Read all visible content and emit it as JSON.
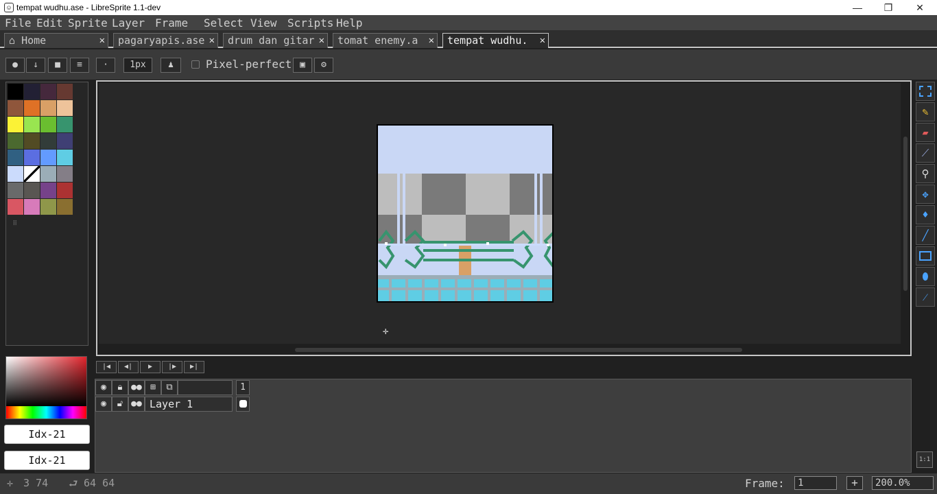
{
  "window": {
    "title": "tempat wudhu.ase - LibreSprite 1.1-dev",
    "minimize_glyph": "—",
    "maximize_glyph": "❐",
    "close_glyph": "✕"
  },
  "menu": [
    "File",
    "Edit",
    "Sprite",
    "Layer",
    "Frame",
    "Select",
    "View",
    "Scripts",
    "Help"
  ],
  "tabs": [
    {
      "label": "Home",
      "active": false
    },
    {
      "label": "pagaryapis.ase",
      "active": false
    },
    {
      "label": "drum dan gitar",
      "active": false
    },
    {
      "label": "tomat enemy.a",
      "active": false
    },
    {
      "label": "tempat wudhu.",
      "active": true
    }
  ],
  "tab_close": "✕",
  "context_bar": {
    "brush_size": "1px",
    "pixel_perfect_label": "Pixel-perfect",
    "pixel_perfect_checked": false
  },
  "palette": [
    "#000000",
    "#222034",
    "#45283c",
    "#663931",
    "#8f563b",
    "#df7126",
    "#d9a066",
    "#eec39a",
    "#fbf236",
    "#99e550",
    "#6abe30",
    "#37946e",
    "#4b692f",
    "#524b24",
    "#323c39",
    "#3f3f74",
    "#306082",
    "#5b6ee1",
    "#639bff",
    "#5fcde4",
    "#cbdbfc",
    "#ffffff",
    "#9badb7",
    "#847e87",
    "#696a6a",
    "#595652",
    "#76428a",
    "#ac3232",
    "#d95763",
    "#d77bba",
    "#8f974a",
    "#8a6f30"
  ],
  "color_bar": {
    "foreground_label": "Idx-21",
    "background_label": "Idx-21"
  },
  "timeline": {
    "frame_header": "1",
    "layers": [
      {
        "name": "Layer 1"
      }
    ]
  },
  "status": {
    "cursor_pos": "3 74",
    "sprite_size": "64 64",
    "frame_label": "Frame:",
    "frame_value": "1",
    "zoom_value": "200.0%",
    "ratio_label": "1:1"
  }
}
